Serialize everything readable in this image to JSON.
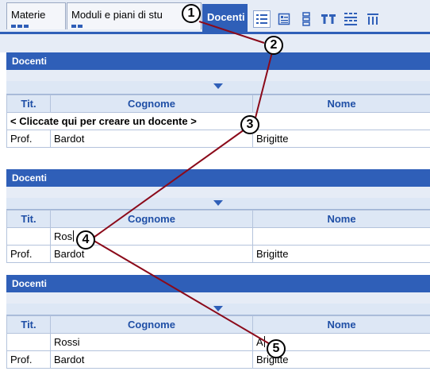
{
  "tabs": [
    {
      "label": "Materie"
    },
    {
      "label": "Moduli e piani di stu"
    },
    {
      "label": "Docenti"
    }
  ],
  "toolbar": {
    "icons": [
      "list-view-icon",
      "form-view-icon",
      "detail-view-icon",
      "text-format-icon",
      "grid-arrange-icon",
      "columns-icon"
    ]
  },
  "panels": [
    {
      "title": "Docenti",
      "headers": {
        "tit": "Tit.",
        "cognome": "Cognome",
        "nome": "Nome"
      },
      "create_prompt": "< Cliccate qui per creare un docente >",
      "rows": [
        {
          "tit": "Prof.",
          "cognome": "Bardot",
          "nome": "Brigitte"
        }
      ]
    },
    {
      "title": "Docenti",
      "headers": {
        "tit": "Tit.",
        "cognome": "Cognome",
        "nome": "Nome"
      },
      "edit_row": {
        "tit": "",
        "cognome": "Ros",
        "nome": ""
      },
      "rows": [
        {
          "tit": "Prof.",
          "cognome": "Bardot",
          "nome": "Brigitte"
        }
      ]
    },
    {
      "title": "Docenti",
      "headers": {
        "tit": "Tit.",
        "cognome": "Cognome",
        "nome": "Nome"
      },
      "edit_row": {
        "tit": "",
        "cognome": "Rossi",
        "nome": "A"
      },
      "rows": [
        {
          "tit": "Prof.",
          "cognome": "Bardot",
          "nome": "Brigitte"
        }
      ]
    }
  ],
  "callouts": [
    "1",
    "2",
    "3",
    "4",
    "5"
  ],
  "colors": {
    "accent": "#2f5fb8",
    "header_bg": "#dde7f5",
    "tab_bar": "#e6ecf6",
    "callout_line": "#8b0a1a"
  }
}
